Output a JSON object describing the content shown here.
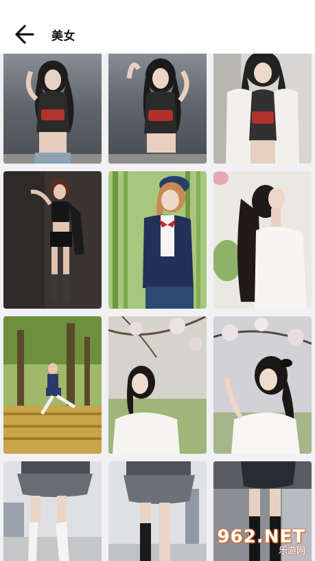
{
  "header": {
    "back_icon": "arrow-left-icon",
    "title": "美女"
  },
  "gallery": {
    "columns": 3,
    "photos": [
      {
        "scene": "seaside-dusk",
        "bg": "#6c7378",
        "accent": "#2f3236"
      },
      {
        "scene": "seaside-dusk",
        "bg": "#6a7075",
        "accent": "#2d3034"
      },
      {
        "scene": "white-shirt",
        "bg": "#dcdcdc",
        "accent": "#3a3838"
      },
      {
        "scene": "dark-studio",
        "bg": "#3b3533",
        "accent": "#1a1818"
      },
      {
        "scene": "bamboo-uniform",
        "bg": "#8fb36a",
        "accent": "#1f2b4d"
      },
      {
        "scene": "sunlit-white-blouse",
        "bg": "#e8e6e0",
        "accent": "#1e1a18"
      },
      {
        "scene": "park-benches",
        "bg": "#7f9a4c",
        "accent": "#2a3a6a"
      },
      {
        "scene": "cherry-blossom",
        "bg": "#c7c2bd",
        "accent": "#f5f3ef"
      },
      {
        "scene": "cherry-blossom",
        "bg": "#c9c8cc",
        "accent": "#f6f6f6"
      },
      {
        "scene": "city-skirt",
        "bg": "#d9dadd",
        "accent": "#4b4d55"
      },
      {
        "scene": "city-skirt",
        "bg": "#d6d8da",
        "accent": "#4e5058"
      },
      {
        "scene": "indoor-skirt",
        "bg": "#8d8f94",
        "accent": "#1c1c1e"
      }
    ]
  },
  "watermark": {
    "main": "962.NET",
    "sub": "乐游网"
  }
}
